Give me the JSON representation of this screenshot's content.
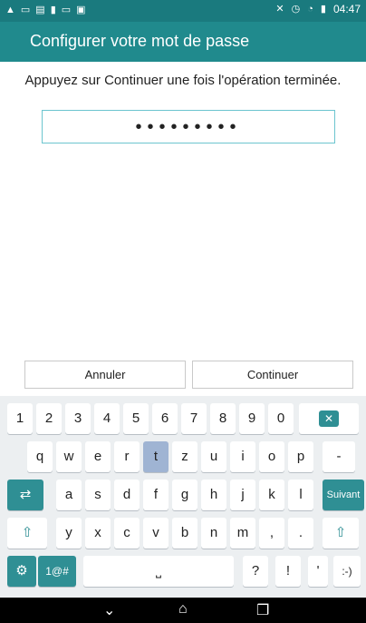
{
  "status_bar": {
    "time": "04:47",
    "left_icons": [
      "warning-icon",
      "message-icon",
      "sim-icon",
      "file-icon",
      "card-icon",
      "download-icon"
    ],
    "right_icons": [
      "mute-icon",
      "alarm-icon",
      "wifi-icon",
      "battery-icon"
    ]
  },
  "header": {
    "title": "Configurer votre mot de passe"
  },
  "instruction": "Appuyez sur Continuer une fois l'opération terminée.",
  "password_field": {
    "value": "•••••••••"
  },
  "buttons": {
    "cancel": "Annuler",
    "continue": "Continuer"
  },
  "keyboard": {
    "row1": [
      "1",
      "2",
      "3",
      "4",
      "5",
      "6",
      "7",
      "8",
      "9",
      "0"
    ],
    "row2": [
      "q",
      "w",
      "e",
      "r",
      "t",
      "z",
      "u",
      "i",
      "o",
      "p",
      "-"
    ],
    "row3": [
      "a",
      "s",
      "d",
      "f",
      "g",
      "h",
      "j",
      "k",
      "l"
    ],
    "next_label": "Suivant",
    "row4": [
      "y",
      "x",
      "c",
      "v",
      "b",
      "n",
      "m",
      ",",
      "."
    ],
    "symbols_label": "1@#",
    "row5_extra": [
      "?",
      "!",
      "'",
      ":-)"
    ]
  },
  "colors": {
    "status": "#1a7a7e",
    "header": "#208a8d",
    "accent": "#2f8f94"
  },
  "nav_icons": [
    "back-icon",
    "home-icon",
    "recents-icon"
  ]
}
